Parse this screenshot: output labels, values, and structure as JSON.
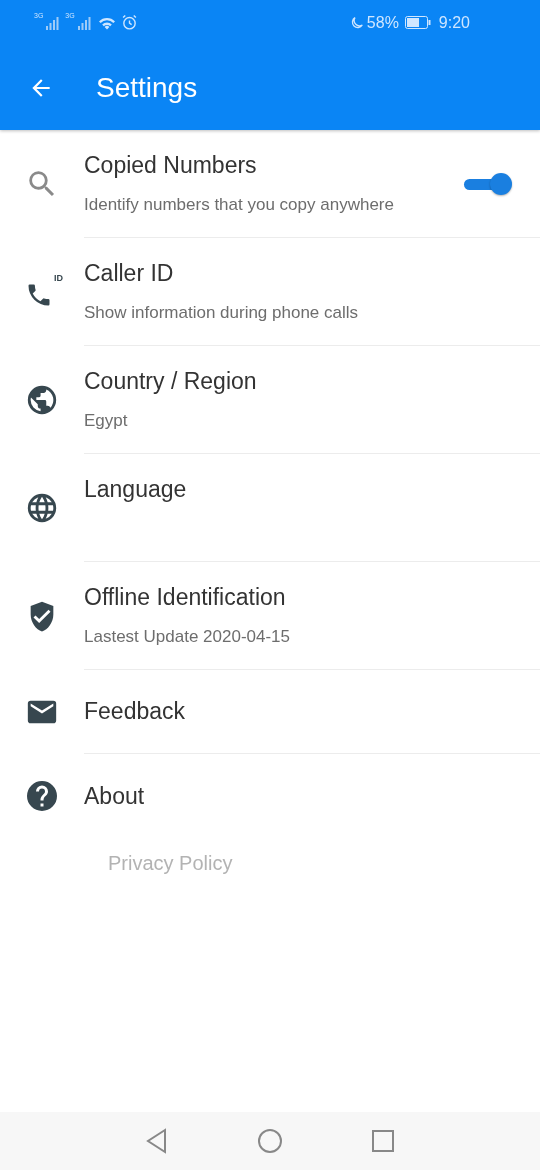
{
  "status_bar": {
    "network_labels": [
      "3G",
      "3G"
    ],
    "battery": "58%",
    "time": "9:20"
  },
  "app_bar": {
    "title": "Settings"
  },
  "items": [
    {
      "kind": "toggle",
      "title": "Copied Numbers",
      "subtitle": "Identify numbers that you copy anywhere",
      "on": true
    },
    {
      "kind": "info",
      "title": "Caller ID",
      "subtitle": "Show information during phone calls",
      "icon_text": "ID"
    },
    {
      "kind": "info",
      "title": "Country / Region",
      "subtitle": "Egypt"
    },
    {
      "kind": "info",
      "title": "Language"
    },
    {
      "kind": "info",
      "title": "Offline Identification",
      "subtitle": "Lastest Update 2020-04-15"
    },
    {
      "kind": "plain",
      "title": "Feedback"
    },
    {
      "kind": "plain",
      "title": "About"
    }
  ],
  "footer_link": "Privacy Policy"
}
